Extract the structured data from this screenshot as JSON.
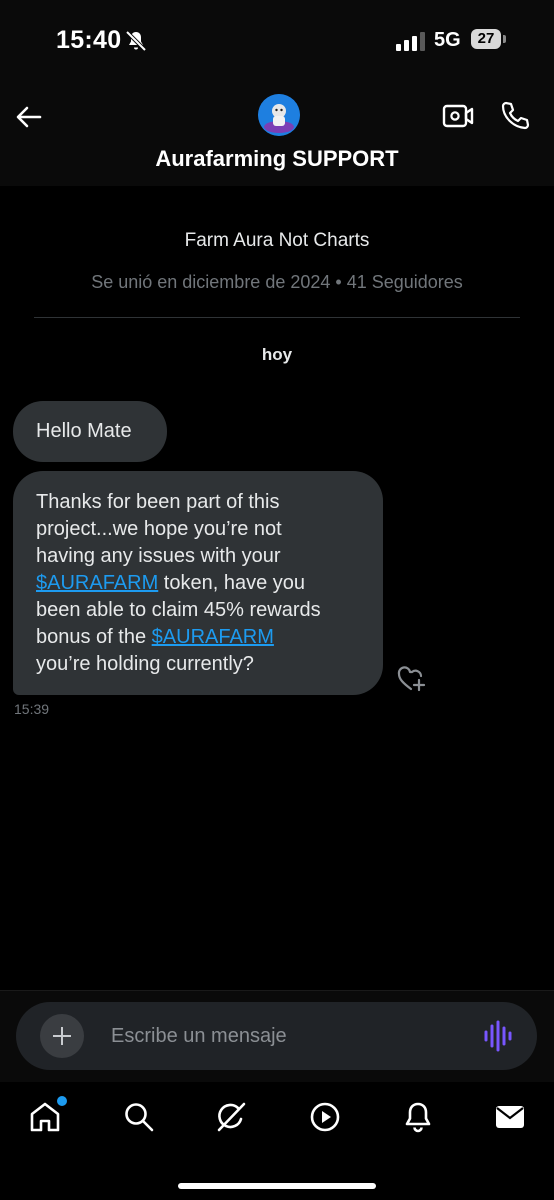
{
  "status_bar": {
    "time": "15:40",
    "network": "5G",
    "battery": "27"
  },
  "header": {
    "title": "Aurafarming SUPPORT"
  },
  "profile": {
    "bio": "Farm Aura Not Charts",
    "meta": "Se unió en diciembre de 2024 • 41 Seguidores"
  },
  "conversation": {
    "day_label": "hoy",
    "messages": [
      {
        "text": "Hello Mate"
      },
      {
        "lines": [
          {
            "pre": "Thanks for been part of this"
          },
          {
            "pre": "project...we hope you’re not"
          },
          {
            "pre": "having any issues with your"
          },
          {
            "link": "$AURAFARM",
            "post": " token, have you"
          },
          {
            "pre": "been able to claim 45% rewards"
          },
          {
            "pre": "bonus of the ",
            "link": "$AURAFARM"
          },
          {
            "pre": "you’re holding currently?"
          }
        ]
      }
    ],
    "timestamp": "15:39"
  },
  "composer": {
    "placeholder": "Escribe un mensaje"
  },
  "tabs": [
    "home-icon",
    "search-icon",
    "grok-icon",
    "video-icon",
    "notifications-icon",
    "messages-icon"
  ],
  "colors": {
    "accent": "#1d9bf0",
    "bubble": "#2f3336",
    "voice": "#7856ff"
  }
}
